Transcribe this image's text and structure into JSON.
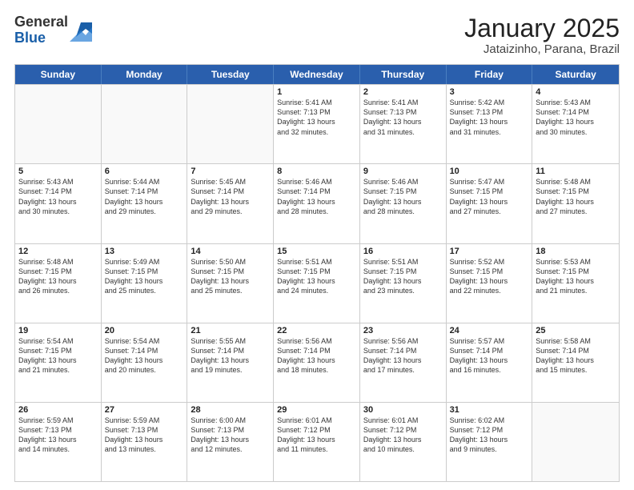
{
  "header": {
    "logo_general": "General",
    "logo_blue": "Blue",
    "title": "January 2025",
    "subtitle": "Jataizinho, Parana, Brazil"
  },
  "weekdays": [
    "Sunday",
    "Monday",
    "Tuesday",
    "Wednesday",
    "Thursday",
    "Friday",
    "Saturday"
  ],
  "weeks": [
    [
      {
        "day": "",
        "info": ""
      },
      {
        "day": "",
        "info": ""
      },
      {
        "day": "",
        "info": ""
      },
      {
        "day": "1",
        "info": "Sunrise: 5:41 AM\nSunset: 7:13 PM\nDaylight: 13 hours\nand 32 minutes."
      },
      {
        "day": "2",
        "info": "Sunrise: 5:41 AM\nSunset: 7:13 PM\nDaylight: 13 hours\nand 31 minutes."
      },
      {
        "day": "3",
        "info": "Sunrise: 5:42 AM\nSunset: 7:13 PM\nDaylight: 13 hours\nand 31 minutes."
      },
      {
        "day": "4",
        "info": "Sunrise: 5:43 AM\nSunset: 7:14 PM\nDaylight: 13 hours\nand 30 minutes."
      }
    ],
    [
      {
        "day": "5",
        "info": "Sunrise: 5:43 AM\nSunset: 7:14 PM\nDaylight: 13 hours\nand 30 minutes."
      },
      {
        "day": "6",
        "info": "Sunrise: 5:44 AM\nSunset: 7:14 PM\nDaylight: 13 hours\nand 29 minutes."
      },
      {
        "day": "7",
        "info": "Sunrise: 5:45 AM\nSunset: 7:14 PM\nDaylight: 13 hours\nand 29 minutes."
      },
      {
        "day": "8",
        "info": "Sunrise: 5:46 AM\nSunset: 7:14 PM\nDaylight: 13 hours\nand 28 minutes."
      },
      {
        "day": "9",
        "info": "Sunrise: 5:46 AM\nSunset: 7:15 PM\nDaylight: 13 hours\nand 28 minutes."
      },
      {
        "day": "10",
        "info": "Sunrise: 5:47 AM\nSunset: 7:15 PM\nDaylight: 13 hours\nand 27 minutes."
      },
      {
        "day": "11",
        "info": "Sunrise: 5:48 AM\nSunset: 7:15 PM\nDaylight: 13 hours\nand 27 minutes."
      }
    ],
    [
      {
        "day": "12",
        "info": "Sunrise: 5:48 AM\nSunset: 7:15 PM\nDaylight: 13 hours\nand 26 minutes."
      },
      {
        "day": "13",
        "info": "Sunrise: 5:49 AM\nSunset: 7:15 PM\nDaylight: 13 hours\nand 25 minutes."
      },
      {
        "day": "14",
        "info": "Sunrise: 5:50 AM\nSunset: 7:15 PM\nDaylight: 13 hours\nand 25 minutes."
      },
      {
        "day": "15",
        "info": "Sunrise: 5:51 AM\nSunset: 7:15 PM\nDaylight: 13 hours\nand 24 minutes."
      },
      {
        "day": "16",
        "info": "Sunrise: 5:51 AM\nSunset: 7:15 PM\nDaylight: 13 hours\nand 23 minutes."
      },
      {
        "day": "17",
        "info": "Sunrise: 5:52 AM\nSunset: 7:15 PM\nDaylight: 13 hours\nand 22 minutes."
      },
      {
        "day": "18",
        "info": "Sunrise: 5:53 AM\nSunset: 7:15 PM\nDaylight: 13 hours\nand 21 minutes."
      }
    ],
    [
      {
        "day": "19",
        "info": "Sunrise: 5:54 AM\nSunset: 7:15 PM\nDaylight: 13 hours\nand 21 minutes."
      },
      {
        "day": "20",
        "info": "Sunrise: 5:54 AM\nSunset: 7:14 PM\nDaylight: 13 hours\nand 20 minutes."
      },
      {
        "day": "21",
        "info": "Sunrise: 5:55 AM\nSunset: 7:14 PM\nDaylight: 13 hours\nand 19 minutes."
      },
      {
        "day": "22",
        "info": "Sunrise: 5:56 AM\nSunset: 7:14 PM\nDaylight: 13 hours\nand 18 minutes."
      },
      {
        "day": "23",
        "info": "Sunrise: 5:56 AM\nSunset: 7:14 PM\nDaylight: 13 hours\nand 17 minutes."
      },
      {
        "day": "24",
        "info": "Sunrise: 5:57 AM\nSunset: 7:14 PM\nDaylight: 13 hours\nand 16 minutes."
      },
      {
        "day": "25",
        "info": "Sunrise: 5:58 AM\nSunset: 7:14 PM\nDaylight: 13 hours\nand 15 minutes."
      }
    ],
    [
      {
        "day": "26",
        "info": "Sunrise: 5:59 AM\nSunset: 7:13 PM\nDaylight: 13 hours\nand 14 minutes."
      },
      {
        "day": "27",
        "info": "Sunrise: 5:59 AM\nSunset: 7:13 PM\nDaylight: 13 hours\nand 13 minutes."
      },
      {
        "day": "28",
        "info": "Sunrise: 6:00 AM\nSunset: 7:13 PM\nDaylight: 13 hours\nand 12 minutes."
      },
      {
        "day": "29",
        "info": "Sunrise: 6:01 AM\nSunset: 7:12 PM\nDaylight: 13 hours\nand 11 minutes."
      },
      {
        "day": "30",
        "info": "Sunrise: 6:01 AM\nSunset: 7:12 PM\nDaylight: 13 hours\nand 10 minutes."
      },
      {
        "day": "31",
        "info": "Sunrise: 6:02 AM\nSunset: 7:12 PM\nDaylight: 13 hours\nand 9 minutes."
      },
      {
        "day": "",
        "info": ""
      }
    ]
  ]
}
